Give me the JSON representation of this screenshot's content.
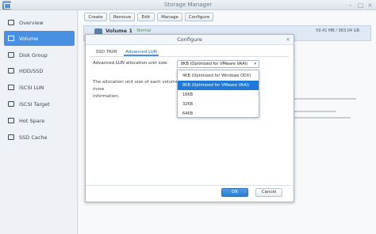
{
  "window": {
    "title": "Storage Manager"
  },
  "sidebar": {
    "items": [
      {
        "label": "Overview",
        "icon": "overview-icon"
      },
      {
        "label": "Volume",
        "icon": "volume-icon",
        "active": true
      },
      {
        "label": "Disk Group",
        "icon": "disk-group-icon"
      },
      {
        "label": "HDD/SSD",
        "icon": "hdd-icon"
      },
      {
        "label": "iSCSI LUN",
        "icon": "lun-icon"
      },
      {
        "label": "iSCSI Target",
        "icon": "target-icon"
      },
      {
        "label": "Hot Spare",
        "icon": "hot-spare-icon"
      },
      {
        "label": "SSD Cache",
        "icon": "ssd-cache-icon"
      }
    ]
  },
  "toolbar": {
    "create": "Create",
    "remove": "Remove",
    "edit": "Edit",
    "manage": "Manage",
    "configure": "Configure"
  },
  "volume": {
    "name": "Volume 1",
    "status": "- Normal",
    "size": "59.41 MB / 983.04 GB"
  },
  "dialog": {
    "title": "Configure",
    "tabs": [
      "SSD TRIM",
      "Advanced LUN"
    ],
    "active_tab": "Advanced LUN",
    "field_label": "Advanced LUN allocation unit size:",
    "selected_value": "8KB (Optimized for VMware VAAI)",
    "description_start": "The allocation unit size of each volume can",
    "description_end": "more",
    "description_line2": "information.",
    "options": [
      "4KB (Optimized for Windows ODX)",
      "8KB (Optimized for VMware VAAI)",
      "16KB",
      "32KB",
      "64KB"
    ],
    "ok_label": "OK",
    "cancel_label": "Cancel"
  },
  "colors": {
    "accent": "#4a90e2",
    "selected": "#1e7ad6",
    "status_ok": "#3a9a3a"
  }
}
